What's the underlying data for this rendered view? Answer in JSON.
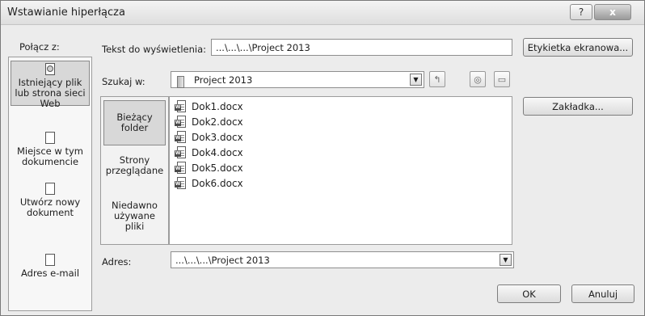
{
  "window": {
    "title": "Wstawianie hiperłącza",
    "help_label": "?",
    "close_label": "x"
  },
  "link_to": {
    "label": "Połącz z:",
    "items": [
      {
        "icon": "existing-file-icon",
        "label": "Istniejący plik lub strona sieci Web",
        "selected": true
      },
      {
        "icon": "place-in-document-icon",
        "label": "Miejsce w tym dokumencie",
        "selected": false
      },
      {
        "icon": "new-document-icon",
        "label": "Utwórz nowy dokument",
        "selected": false
      },
      {
        "icon": "email-address-icon",
        "label": "Adres e-mail",
        "selected": false
      }
    ]
  },
  "display_text": {
    "label": "Tekst do wyświetlenia:",
    "value": "...\\...\\...\\Project 2013"
  },
  "screentip_button": "Etykietka ekranowa...",
  "look_in": {
    "label": "Szukaj w:",
    "value": "Project 2013",
    "folder_icon": "folder-icon",
    "up_icon": "up-one-folder-icon",
    "browse_web_icon": "browse-web-icon",
    "browse_file_icon": "browse-file-icon"
  },
  "browse_nav": [
    {
      "label": "Bieżący folder",
      "selected": true
    },
    {
      "label": "Strony przeglądane",
      "selected": false
    },
    {
      "label": "Niedawno używane pliki",
      "selected": false
    }
  ],
  "files": [
    "Dok1.docx",
    "Dok2.docx",
    "Dok3.docx",
    "Dok4.docx",
    "Dok5.docx",
    "Dok6.docx"
  ],
  "bookmark_button": "Zakładka...",
  "address": {
    "label": "Adres:",
    "value": "...\\...\\...\\Project 2013"
  },
  "ok_button": "OK",
  "cancel_button": "Anuluj"
}
